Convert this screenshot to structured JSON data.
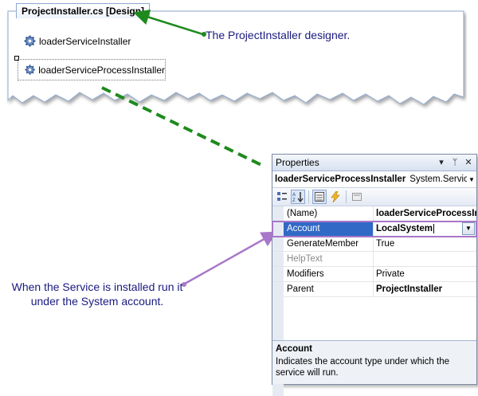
{
  "designer": {
    "tab_title": "ProjectInstaller.cs [Design]",
    "components": [
      {
        "label": "loaderServiceInstaller"
      },
      {
        "label": "loaderServiceProcessInstaller"
      }
    ]
  },
  "annotations": {
    "designer_note": "The ProjectInstaller designer.",
    "account_note": "When the Service is installed run it under the System account."
  },
  "properties": {
    "title": "Properties",
    "title_buttons": [
      "▾",
      "ᛘ",
      "✕"
    ],
    "object_name": "loaderServiceProcessInstaller",
    "object_type": "System.Service",
    "rows": [
      {
        "name": "(Name)",
        "value": "loaderServiceProcessInstaller"
      },
      {
        "name": "Account",
        "value": "LocalSystem"
      },
      {
        "name": "GenerateMember",
        "value": "True"
      },
      {
        "name": "HelpText",
        "value": ""
      },
      {
        "name": "Modifiers",
        "value": "Private"
      },
      {
        "name": "Parent",
        "value": "ProjectInstaller"
      }
    ],
    "description": {
      "title": "Account",
      "text": "Indicates the account type under which the service will run."
    }
  },
  "colors": {
    "green_arrow": "#1e8a1e",
    "purple_arrow": "#a877c9",
    "annotation_text": "#1a1a80",
    "selection": "#3169c6"
  }
}
